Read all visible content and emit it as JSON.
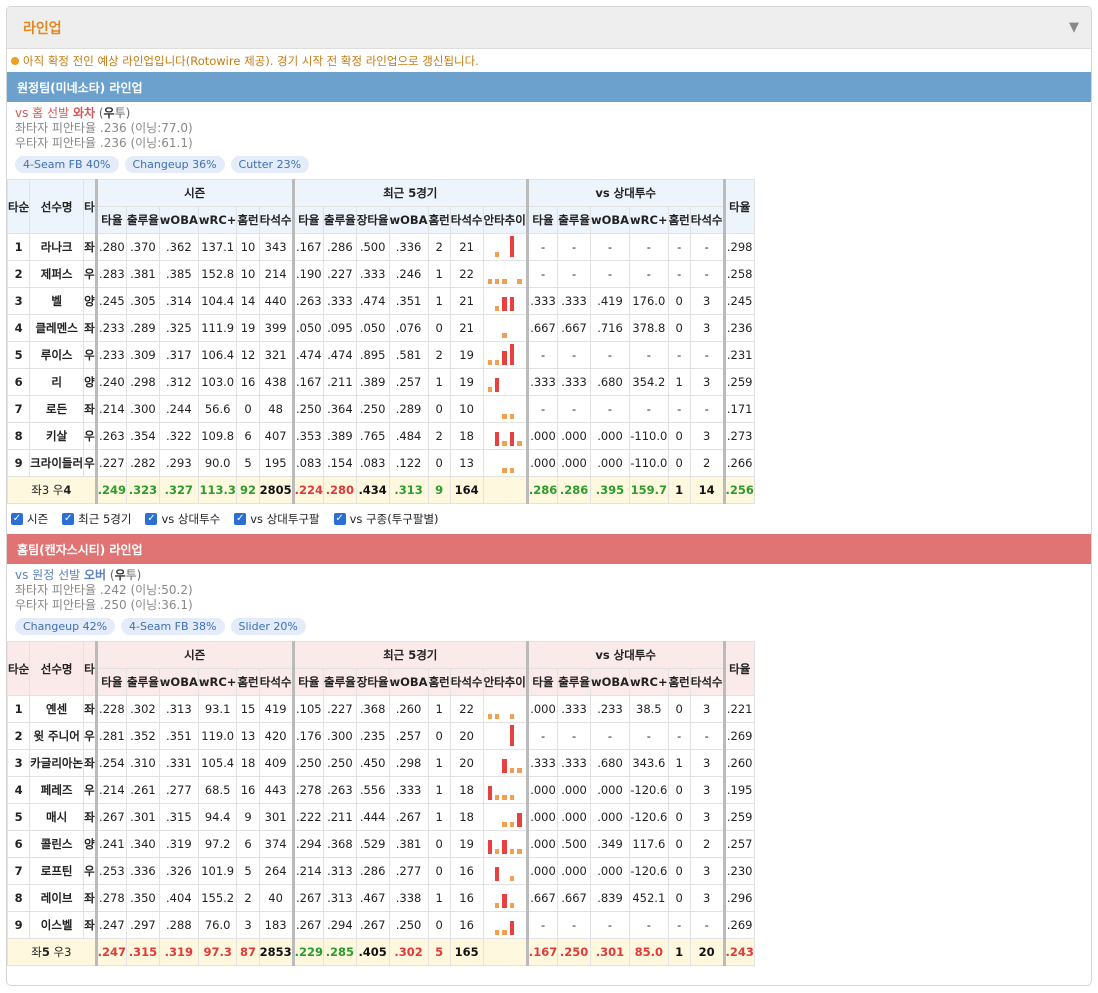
{
  "header": {
    "title": "라인업",
    "collapse_icon": "▼"
  },
  "notice": "아직 확정 전인 예상 라인업입니다(Rotowire 제공). 경기 시작 전 확정 라인업으로 갱신됩니다.",
  "columns": {
    "groups": [
      "시즌",
      "최근 5경기",
      "vs 상대투수"
    ],
    "order": "타순",
    "name": "선수명",
    "hand": "타",
    "season": [
      "타율",
      "출루율",
      "wOBA",
      "wRC+",
      "홈런",
      "타석수"
    ],
    "recent": [
      "타율",
      "출루율",
      "장타율",
      "wOBA",
      "홈런",
      "타석수",
      "안타추이"
    ],
    "vs": [
      "타율",
      "출루율",
      "wOBA",
      "wRC+",
      "홈런",
      "타석수"
    ],
    "extra": "타율"
  },
  "away": {
    "title": "원정팀(미네소타) 라인업",
    "pitcher": {
      "vs": "vs 홈 선발",
      "name": "와차",
      "hand_open": "(",
      "hand": "우",
      "hand_close": "투)"
    },
    "split_l": "좌타자 피안타율 .236 (이닝:77.0)",
    "split_r": "우타자 피안타율 .236 (이닝:61.1)",
    "pitches": [
      "4-Seam FB 40%",
      "Changeup 36%",
      "Cutter 23%"
    ],
    "rows": [
      {
        "no": "1",
        "name": "라나크",
        "hand": "좌",
        "s": [
          ".280",
          ".370",
          ".362",
          "137.1",
          "10",
          "343"
        ],
        "r": [
          ".167",
          ".286",
          ".500",
          ".336",
          "2",
          "21"
        ],
        "spark": "n0n2n",
        "v": [
          "-",
          "-",
          "-",
          "-",
          "-",
          "-"
        ],
        "e": ".298"
      },
      {
        "no": "2",
        "name": "제퍼스",
        "hand": "우",
        "s": [
          ".283",
          ".381",
          ".385",
          "152.8",
          "10",
          "214"
        ],
        "r": [
          ".190",
          ".227",
          ".333",
          ".246",
          "1",
          "22"
        ],
        "spark": "000n0",
        "v": [
          "-",
          "-",
          "-",
          "-",
          "-",
          "-"
        ],
        "e": ".258"
      },
      {
        "no": "3",
        "name": "벨",
        "hand": "양",
        "s": [
          ".245",
          ".305",
          ".314",
          "104.4",
          "14",
          "440"
        ],
        "r": [
          ".263",
          ".333",
          ".474",
          ".351",
          "1",
          "21"
        ],
        "spark": "n011n",
        "v": [
          ".333",
          ".333",
          ".419",
          "176.0",
          "0",
          "3"
        ],
        "e": ".245"
      },
      {
        "no": "4",
        "name": "클레멘스",
        "hand": "좌",
        "s": [
          ".233",
          ".289",
          ".325",
          "111.9",
          "19",
          "399"
        ],
        "r": [
          ".050",
          ".095",
          ".050",
          ".076",
          "0",
          "21"
        ],
        "spark": "nn0nn",
        "v": [
          ".667",
          ".667",
          ".716",
          "378.8",
          "0",
          "3"
        ],
        "e": ".236"
      },
      {
        "no": "5",
        "name": "루이스",
        "hand": "우",
        "s": [
          ".233",
          ".309",
          ".317",
          "106.4",
          "12",
          "321"
        ],
        "r": [
          ".474",
          ".474",
          ".895",
          ".581",
          "2",
          "19"
        ],
        "spark": "0012n",
        "v": [
          "-",
          "-",
          "-",
          "-",
          "-",
          "-"
        ],
        "e": ".231"
      },
      {
        "no": "6",
        "name": "리",
        "hand": "양",
        "s": [
          ".240",
          ".298",
          ".312",
          "103.0",
          "16",
          "438"
        ],
        "r": [
          ".167",
          ".211",
          ".389",
          ".257",
          "1",
          "19"
        ],
        "spark": "01nnn",
        "v": [
          ".333",
          ".333",
          ".680",
          "354.2",
          "1",
          "3"
        ],
        "e": ".259"
      },
      {
        "no": "7",
        "name": "로든",
        "hand": "좌",
        "s": [
          ".214",
          ".300",
          ".244",
          "56.6",
          "0",
          "48"
        ],
        "r": [
          ".250",
          ".364",
          ".250",
          ".289",
          "0",
          "10"
        ],
        "spark": "nn00n",
        "v": [
          "-",
          "-",
          "-",
          "-",
          "-",
          "-"
        ],
        "e": ".171"
      },
      {
        "no": "8",
        "name": "키살",
        "hand": "우",
        "s": [
          ".263",
          ".354",
          ".322",
          "109.8",
          "6",
          "407"
        ],
        "r": [
          ".353",
          ".389",
          ".765",
          ".484",
          "2",
          "18"
        ],
        "spark": "n1010",
        "v": [
          ".000",
          ".000",
          ".000",
          "-110.0",
          "0",
          "3"
        ],
        "e": ".273"
      },
      {
        "no": "9",
        "name": "크라이들러",
        "hand": "우",
        "s": [
          ".227",
          ".282",
          ".293",
          "90.0",
          "5",
          "195"
        ],
        "r": [
          ".083",
          ".154",
          ".083",
          ".122",
          "0",
          "13"
        ],
        "spark": "nn00n",
        "v": [
          ".000",
          ".000",
          ".000",
          "-110.0",
          "0",
          "2"
        ],
        "e": ".266"
      }
    ],
    "total": {
      "label_a": "좌3 우",
      "label_b": "4",
      "s": [
        ".249",
        ".323",
        ".327",
        "113.3",
        "92",
        "2805"
      ],
      "r": [
        ".224",
        ".280",
        ".434",
        ".313",
        "9",
        "164"
      ],
      "v": [
        ".286",
        ".286",
        ".395",
        "159.7",
        "1",
        "14"
      ],
      "e": ".256"
    }
  },
  "filters": [
    "시즌",
    "최근 5경기",
    "vs 상대투수",
    "vs 상대투구팔",
    "vs 구종(투구팔별)"
  ],
  "home": {
    "title": "홈팀(캔자스시티) 라인업",
    "pitcher": {
      "vs": "vs 원정 선발",
      "name": "오버",
      "hand_open": "(",
      "hand": "우",
      "hand_close": "투)"
    },
    "split_l": "좌타자 피안타율 .242 (이닝:50.2)",
    "split_r": "우타자 피안타율 .250 (이닝:36.1)",
    "pitches": [
      "Changeup 42%",
      "4-Seam FB 38%",
      "Slider 20%"
    ],
    "rows": [
      {
        "no": "1",
        "name": "옌센",
        "hand": "좌",
        "s": [
          ".228",
          ".302",
          ".313",
          "93.1",
          "15",
          "419"
        ],
        "r": [
          ".105",
          ".227",
          ".368",
          ".260",
          "1",
          "22"
        ],
        "spark": "00n0n",
        "v": [
          ".000",
          ".333",
          ".233",
          "38.5",
          "0",
          "3"
        ],
        "e": ".221"
      },
      {
        "no": "2",
        "name": "윗 주니어",
        "hand": "우",
        "s": [
          ".281",
          ".352",
          ".351",
          "119.0",
          "13",
          "420"
        ],
        "r": [
          ".176",
          ".300",
          ".235",
          ".257",
          "0",
          "20"
        ],
        "spark": "nnn2n",
        "v": [
          "-",
          "-",
          "-",
          "-",
          "-",
          "-"
        ],
        "e": ".269"
      },
      {
        "no": "3",
        "name": "카글리아논",
        "hand": "좌",
        "s": [
          ".254",
          ".310",
          ".331",
          "105.4",
          "18",
          "409"
        ],
        "r": [
          ".250",
          ".250",
          ".450",
          ".298",
          "1",
          "20"
        ],
        "spark": "nn100",
        "v": [
          ".333",
          ".333",
          ".680",
          "343.6",
          "1",
          "3"
        ],
        "e": ".260"
      },
      {
        "no": "4",
        "name": "페레즈",
        "hand": "우",
        "s": [
          ".214",
          ".261",
          ".277",
          "68.5",
          "16",
          "443"
        ],
        "r": [
          ".278",
          ".263",
          ".556",
          ".333",
          "1",
          "18"
        ],
        "spark": "1000n",
        "v": [
          ".000",
          ".000",
          ".000",
          "-120.6",
          "0",
          "3"
        ],
        "e": ".195"
      },
      {
        "no": "5",
        "name": "매시",
        "hand": "좌",
        "s": [
          ".267",
          ".301",
          ".315",
          "94.4",
          "9",
          "301"
        ],
        "r": [
          ".222",
          ".211",
          ".444",
          ".267",
          "1",
          "18"
        ],
        "spark": "nn001",
        "v": [
          ".000",
          ".000",
          ".000",
          "-120.6",
          "0",
          "3"
        ],
        "e": ".259"
      },
      {
        "no": "6",
        "name": "콜린스",
        "hand": "양",
        "s": [
          ".241",
          ".340",
          ".319",
          "97.2",
          "6",
          "374"
        ],
        "r": [
          ".294",
          ".368",
          ".529",
          ".381",
          "0",
          "19"
        ],
        "spark": "10100",
        "v": [
          ".000",
          ".500",
          ".349",
          "117.6",
          "0",
          "2"
        ],
        "e": ".257"
      },
      {
        "no": "7",
        "name": "로프틴",
        "hand": "우",
        "s": [
          ".253",
          ".336",
          ".326",
          "101.9",
          "5",
          "264"
        ],
        "r": [
          ".214",
          ".313",
          ".286",
          ".277",
          "0",
          "16"
        ],
        "spark": "n1n0n",
        "v": [
          ".000",
          ".000",
          ".000",
          "-120.6",
          "0",
          "3"
        ],
        "e": ".230"
      },
      {
        "no": "8",
        "name": "레이브",
        "hand": "좌",
        "s": [
          ".278",
          ".350",
          ".404",
          "155.2",
          "2",
          "40"
        ],
        "r": [
          ".267",
          ".313",
          ".467",
          ".338",
          "1",
          "16"
        ],
        "spark": "n010n",
        "v": [
          ".667",
          ".667",
          ".839",
          "452.1",
          "0",
          "3"
        ],
        "e": ".296"
      },
      {
        "no": "9",
        "name": "이스벨",
        "hand": "좌",
        "s": [
          ".247",
          ".297",
          ".288",
          "76.0",
          "3",
          "183"
        ],
        "r": [
          ".267",
          ".294",
          ".267",
          ".250",
          "0",
          "16"
        ],
        "spark": "n001n",
        "v": [
          "-",
          "-",
          "-",
          "-",
          "-",
          "-"
        ],
        "e": ".269"
      }
    ],
    "total": {
      "label_a": "좌",
      "label_b": "5",
      "label_c": " 우3",
      "s": [
        ".247",
        ".315",
        ".319",
        "97.3",
        "87",
        "2853"
      ],
      "r": [
        ".229",
        ".285",
        ".405",
        ".302",
        "5",
        "165"
      ],
      "v": [
        ".167",
        ".250",
        ".301",
        "85.0",
        "1",
        "20"
      ],
      "e": ".243"
    }
  },
  "colors": {
    "away_bar": "#6ca0cd",
    "home_bar": "#e07474",
    "good": "#2d9b2d",
    "bad": "#e03a3a",
    "spark_hit": "#e8403e",
    "spark_out": "#f0a050"
  }
}
